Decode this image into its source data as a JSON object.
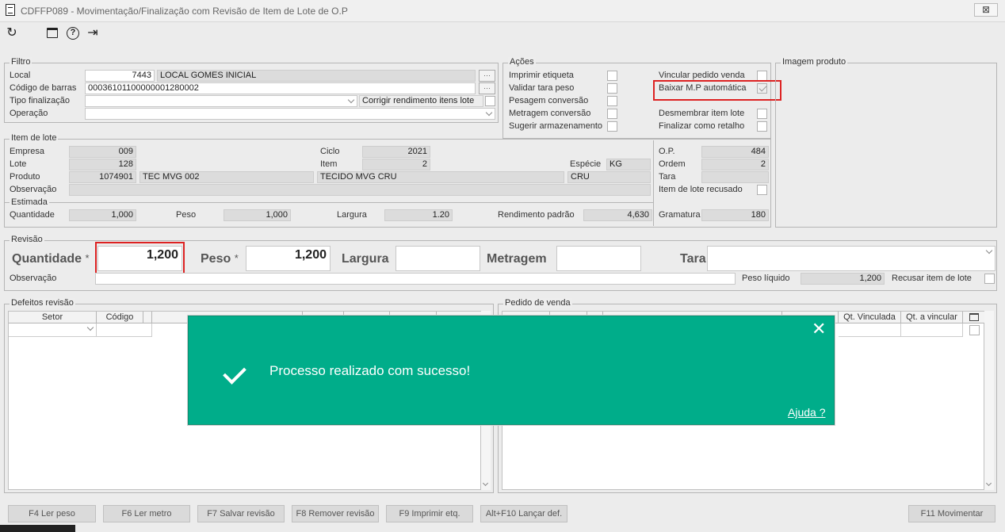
{
  "window": {
    "title": "CDFFP089 - Movimentação/Finalização com Revisão de Item de Lote de O.P",
    "close": "⊠"
  },
  "toolbar": {
    "refresh": "↻",
    "calendar": "📅",
    "help": "?",
    "exit": "⇥"
  },
  "filtro": {
    "legend": "Filtro",
    "local_label": "Local",
    "local_code": "7443",
    "local_name": "LOCAL GOMES INICIAL",
    "barcode_label": "Código de barras",
    "barcode": "00036101100000001280002",
    "tipo_label": "Tipo finalização",
    "tipo_value": "",
    "corrigir_label": "Corrigir rendimento itens lote",
    "operacao_label": "Operação",
    "operacao_value": ""
  },
  "acoes": {
    "legend": "Ações",
    "left": [
      "Imprimir etiqueta",
      "Validar tara peso",
      "Pesagem conversão",
      "Metragem conversão",
      "Sugerir armazenamento"
    ],
    "right": [
      "Vincular pedido venda",
      "Baixar M.P automática",
      "",
      "Desmembrar item lote",
      "Finalizar como retalho"
    ],
    "right_checked": [
      false,
      true,
      false,
      false,
      false
    ]
  },
  "imagem": {
    "legend": "Imagem produto"
  },
  "item": {
    "legend": "Item de lote",
    "empresa_label": "Empresa",
    "empresa": "009",
    "lote_label": "Lote",
    "lote": "128",
    "produto_label": "Produto",
    "produto": "1074901",
    "produto_nome": "TEC MVG 002",
    "obs_label": "Observação",
    "obs": "",
    "ciclo_label": "Ciclo",
    "ciclo": "2021",
    "item_label": "Item",
    "item": "2",
    "item_nome": "TECIDO MVG CRU",
    "especie_label": "Espécie",
    "especie": "KG",
    "cru": "CRU",
    "op_label": "O.P.",
    "op": "484",
    "ordem_label": "Ordem",
    "ordem": "2",
    "tara_label": "Tara",
    "tara": "",
    "recusado_label": "Item de lote recusado"
  },
  "estimada": {
    "legend": "Estimada",
    "quantidade_label": "Quantidade",
    "quantidade": "1,000",
    "peso_label": "Peso",
    "peso": "1,000",
    "largura_label": "Largura",
    "largura": "1.20",
    "rend_label": "Rendimento padrão",
    "rend": "4,630",
    "gramatura_label": "Gramatura",
    "gramatura": "180"
  },
  "revisao": {
    "legend": "Revisão",
    "quantidade_label": "Quantidade",
    "quantidade": "1,200",
    "peso_label": "Peso",
    "peso": "1,200",
    "largura_label": "Largura",
    "largura": "",
    "metragem_label": "Metragem",
    "metragem": "",
    "tara_label": "Tara",
    "tara": "",
    "obs_label": "Observação",
    "obs": "",
    "peso_liquido_label": "Peso líquido",
    "peso_liquido": "1,200",
    "recusar_label": "Recusar item de lote",
    "star": "*"
  },
  "defeitos": {
    "legend": "Defeitos revisão",
    "headers": [
      "Setor",
      "Código"
    ]
  },
  "pedido": {
    "legend": "Pedido de venda",
    "headers": [
      "Qt. Vinculada",
      "Qt. a vincular"
    ]
  },
  "buttons": [
    "F4 Ler peso",
    "F6 Ler metro",
    "F7 Salvar revisão",
    "F8 Remover revisão",
    "F9 Imprimir etq.",
    "Alt+F10 Lançar def.",
    "F11 Movimentar"
  ],
  "toast": {
    "message": "Processo realizado com sucesso!",
    "close": "✕",
    "help": "Ajuda ?"
  }
}
